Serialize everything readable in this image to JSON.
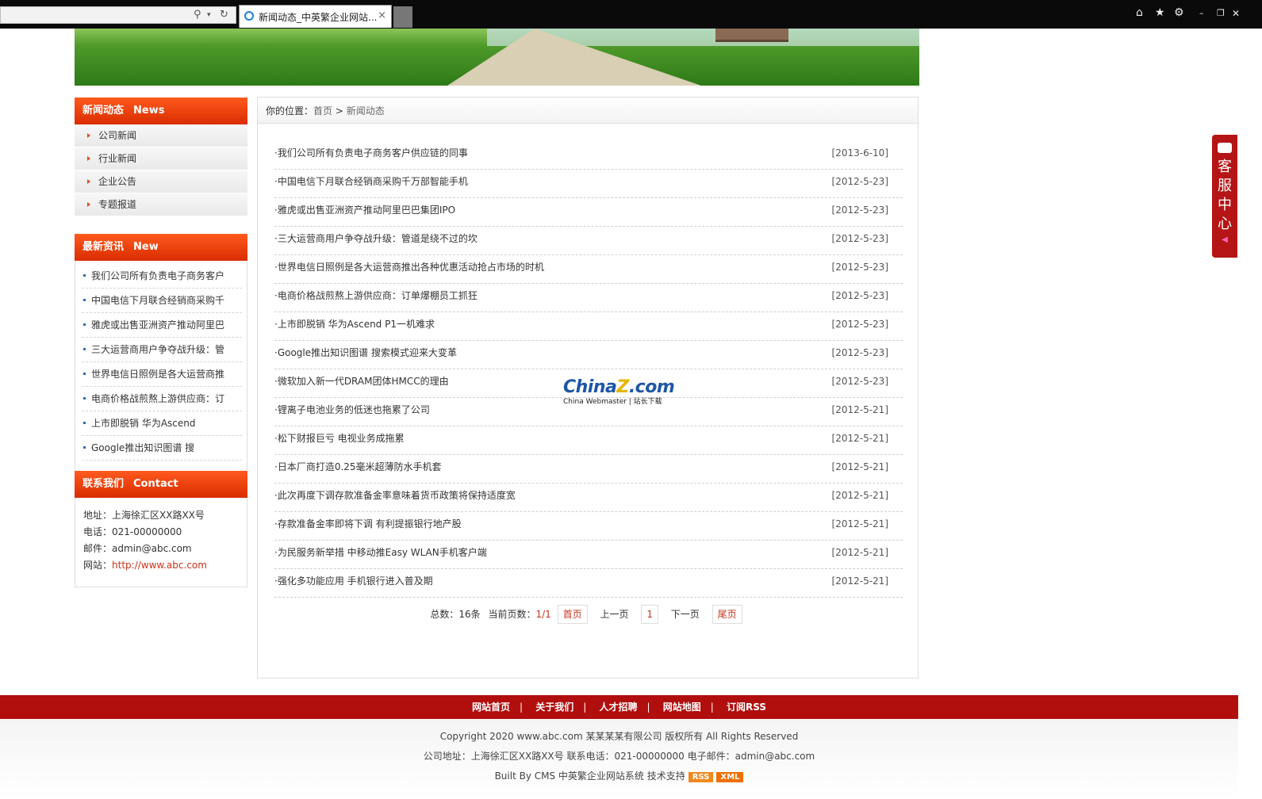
{
  "browser": {
    "tab_title": "新闻动态_中英繁企业网站...",
    "close_glyph": "×"
  },
  "sidebar": {
    "news_section": {
      "title": "新闻动态",
      "title_en": "News",
      "categories": [
        "公司新闻",
        "行业新闻",
        "企业公告",
        "专题报道"
      ]
    },
    "latest_section": {
      "title": "最新资讯",
      "title_en": "New",
      "items": [
        "我们公司所有负责电子商务客户",
        "中国电信下月联合经销商采购千",
        "雅虎或出售亚洲资产推动阿里巴",
        "三大运营商用户争夺战升级：管",
        "世界电信日照例是各大运营商推",
        "电商价格战煎熬上游供应商：订",
        "上市即脱销 华为Ascend",
        "Google推出知识图谱 搜"
      ]
    },
    "contact_section": {
      "title": "联系我们",
      "title_en": "Contact",
      "address": "地址：上海徐汇区XX路XX号",
      "phone": "电话：021-00000000",
      "email": "邮件：admin@abc.com",
      "website_label": "网站：",
      "website_url": "http://www.abc.com"
    }
  },
  "breadcrumb": {
    "prefix": "你的位置：",
    "home": "首页",
    "sep": ">",
    "current": "新闻动态"
  },
  "articles": [
    {
      "title": "·我们公司所有负责电子商务客户供应链的同事",
      "date": "[2013-6-10]"
    },
    {
      "title": "·中国电信下月联合经销商采购千万部智能手机",
      "date": "[2012-5-23]"
    },
    {
      "title": "·雅虎或出售亚洲资产推动阿里巴巴集团IPO",
      "date": "[2012-5-23]"
    },
    {
      "title": "·三大运营商用户争夺战升级：管道是绕不过的坎",
      "date": "[2012-5-23]"
    },
    {
      "title": "·世界电信日照例是各大运营商推出各种优惠活动抢占市场的时机",
      "date": "[2012-5-23]"
    },
    {
      "title": "·电商价格战煎熬上游供应商：订单爆棚员工抓狂",
      "date": "[2012-5-23]"
    },
    {
      "title": "·上市即脱销 华为Ascend P1一机难求",
      "date": "[2012-5-23]"
    },
    {
      "title": "·Google推出知识图谱 搜索模式迎来大变革",
      "date": "[2012-5-23]"
    },
    {
      "title": "·微软加入新一代DRAM团体HMCC的理由",
      "date": "[2012-5-23]"
    },
    {
      "title": "·锂离子电池业务的低迷也拖累了公司",
      "date": "[2012-5-21]"
    },
    {
      "title": "·松下财报巨亏 电视业务成拖累",
      "date": "[2012-5-21]"
    },
    {
      "title": "·日本厂商打造0.25毫米超薄防水手机套",
      "date": "[2012-5-21]"
    },
    {
      "title": "·此次再度下调存款准备金率意味着货币政策将保持适度宽",
      "date": "[2012-5-21]"
    },
    {
      "title": "·存款准备金率即将下调 有利提振银行地产股",
      "date": "[2012-5-21]"
    },
    {
      "title": "·为民服务新举措 中移动推Easy WLAN手机客户端",
      "date": "[2012-5-21]"
    },
    {
      "title": "·强化多功能应用 手机银行进入普及期",
      "date": "[2012-5-21]"
    }
  ],
  "pager": {
    "total": "总数：16条",
    "current_label": "当前页数：",
    "current_value": "1/1",
    "first": "首页",
    "prev": "上一页",
    "page1": "1",
    "next": "下一页",
    "last": "尾页"
  },
  "watermark": {
    "brand_a": "China",
    "brand_z": "Z",
    "brand_b": ".com",
    "tagline": "China Webmaster | 站长下载"
  },
  "kefu": {
    "chars": [
      "客",
      "服",
      "中",
      "心"
    ]
  },
  "footer_nav": [
    "网站首页",
    "关于我们",
    "人才招聘",
    "网站地图",
    "订阅RSS"
  ],
  "footer_sep": "|",
  "footer": {
    "copyright": "Copyright 2020 www.abc.com 某某某某有限公司 版权所有 All Rights Reserved",
    "address_line": "公司地址：上海徐汇区XX路XX号 联系电话：021-00000000 电子邮件：admin@abc.com",
    "built_by": "Built By CMS 中英繁企业网站系统 技术支持",
    "rss": "RSS",
    "xml": "XML"
  },
  "colors": {
    "accent": "#d92c00",
    "footer_bar": "#b10e0e",
    "link_red": "#c8321a"
  }
}
